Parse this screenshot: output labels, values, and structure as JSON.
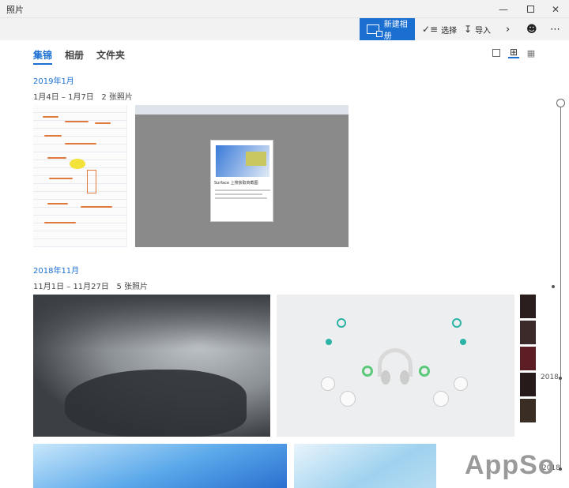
{
  "window": {
    "title": "照片"
  },
  "toolbar": {
    "new_album": "新建相册",
    "select": "选择",
    "import": "导入"
  },
  "tabs": [
    {
      "label": "集锦",
      "active": true
    },
    {
      "label": "相册",
      "active": false
    },
    {
      "label": "文件夹",
      "active": false
    }
  ],
  "groups": [
    {
      "month": "2019年1月",
      "range": "1月4日 – 1月7日",
      "count": "2 张照片"
    },
    {
      "month": "2018年11月",
      "range": "11月1日 – 11月27日",
      "count": "5 张照片"
    }
  ],
  "screenshot_dialog": {
    "brand": "Surface",
    "title": "上搜获取商截图"
  },
  "timeline": {
    "year_labels": [
      "2018",
      "2018"
    ]
  },
  "watermark": "AppSo",
  "colors": {
    "accent": "#1a6fd1",
    "chrome": "#f2f2f2"
  }
}
